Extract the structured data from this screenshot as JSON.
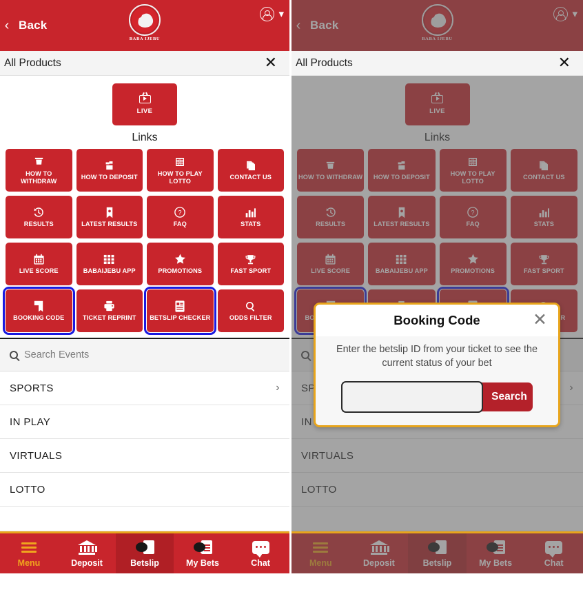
{
  "header": {
    "back_label": "Back",
    "back_icon": "chevron-left-icon",
    "logo_text": "BABA IJEBU",
    "account_icon": "account-circle-icon",
    "caret_icon": "chevron-down-icon"
  },
  "products_bar": {
    "title": "All Products",
    "close_icon": "close-icon"
  },
  "live": {
    "label": "LIVE",
    "icon": "tv-live-icon"
  },
  "links_heading": "Links",
  "tiles": [
    {
      "label": "HOW TO WITHDRAW",
      "icon": "withdraw-icon",
      "glyph": "✇",
      "highlighted": false
    },
    {
      "label": "HOW TO DEPOSIT",
      "icon": "deposit-icon",
      "glyph": "☙",
      "highlighted": false
    },
    {
      "label": "HOW TO PLAY LOTTO",
      "icon": "lotto-ticket-icon",
      "glyph": "☷",
      "highlighted": false
    },
    {
      "label": "CONTACT US",
      "icon": "documents-icon",
      "glyph": "❐",
      "highlighted": false
    },
    {
      "label": "RESULTS",
      "icon": "history-clock-icon",
      "glyph": "↺",
      "highlighted": false
    },
    {
      "label": "LATEST RESULTS",
      "icon": "bookmark-icon",
      "glyph": "⚑",
      "highlighted": false
    },
    {
      "label": "FAQ",
      "icon": "question-circle-icon",
      "glyph": "?",
      "highlighted": false
    },
    {
      "label": "STATS",
      "icon": "bar-chart-icon",
      "glyph": "█",
      "highlighted": false
    },
    {
      "label": "LIVE SCORE",
      "icon": "calendar-icon",
      "glyph": "▦",
      "highlighted": false
    },
    {
      "label": "BABAIJEBU APP",
      "icon": "grid-apps-icon",
      "glyph": "∷",
      "highlighted": false
    },
    {
      "label": "PROMOTIONS",
      "icon": "star-icon",
      "glyph": "★",
      "highlighted": false
    },
    {
      "label": "FAST SPORT",
      "icon": "trophy-icon",
      "glyph": "Ἴ6",
      "highlighted": false
    },
    {
      "label": "BOOKING CODE",
      "icon": "booking-code-icon",
      "glyph": "▣",
      "highlighted": true
    },
    {
      "label": "TICKET REPRINT",
      "icon": "printer-icon",
      "glyph": "⎙",
      "highlighted": false
    },
    {
      "label": "BETSLIP CHECKER",
      "icon": "betslip-checker-icon",
      "glyph": "☰",
      "highlighted": true
    },
    {
      "label": "ODDS FILTER",
      "icon": "search-odds-icon",
      "glyph": "⌕",
      "highlighted": false
    }
  ],
  "search": {
    "placeholder": "Search Events",
    "icon": "search-icon"
  },
  "nav_rows": [
    {
      "label": "SPORTS",
      "has_arrow": true,
      "arrow_icon": "chevron-right-icon"
    },
    {
      "label": "IN PLAY",
      "has_arrow": false
    },
    {
      "label": "VIRTUALS",
      "has_arrow": false
    },
    {
      "label": "LOTTO",
      "has_arrow": false
    }
  ],
  "bottom_nav": [
    {
      "label": "Menu",
      "icon": "hamburger-menu-icon",
      "state": "active-orange"
    },
    {
      "label": "Deposit",
      "icon": "bank-icon",
      "state": "normal"
    },
    {
      "label": "Betslip",
      "icon": "betslip-icon",
      "state": "active-dark"
    },
    {
      "label": "My Bets",
      "icon": "my-bets-icon",
      "state": "normal"
    },
    {
      "label": "Chat",
      "icon": "chat-bubble-icon",
      "state": "normal"
    }
  ],
  "modal": {
    "title": "Booking Code",
    "close_icon": "close-icon",
    "description": "Enter the betslip ID from your ticket to see the current status of your bet",
    "input_value": "",
    "input_placeholder": "",
    "search_button": "Search"
  },
  "colors": {
    "brand_red": "#c8252c",
    "header_red": "#c8252c",
    "dark_red": "#b01f25",
    "accent_gold": "#e8a51c",
    "highlight_blue": "#1a1ae0",
    "menu_orange": "#f0a41e",
    "modal_border": "#e8a51c",
    "dim_overlay": "rgba(90,90,90,0.55)"
  }
}
